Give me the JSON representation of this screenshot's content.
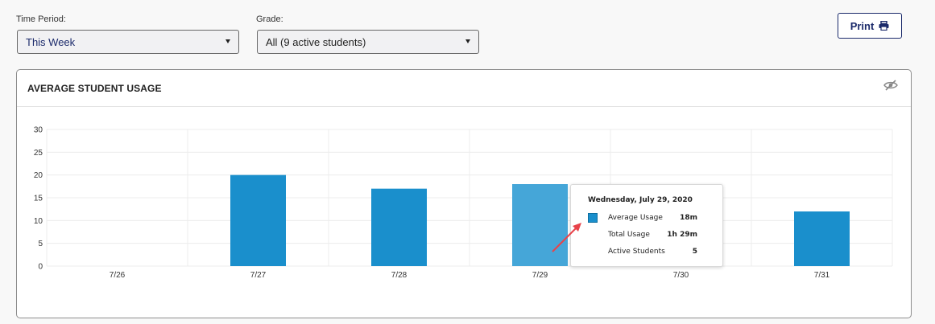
{
  "filters": {
    "time_period": {
      "label": "Time Period:",
      "value": "This Week"
    },
    "grade": {
      "label": "Grade:",
      "value": "All (9 active students)"
    }
  },
  "toolbar": {
    "print_label": "Print"
  },
  "panel": {
    "title": "AVERAGE STUDENT USAGE"
  },
  "chart_data": {
    "type": "bar",
    "title": "",
    "xlabel": "",
    "ylabel": "",
    "categories": [
      "7/26",
      "7/27",
      "7/28",
      "7/29",
      "7/30",
      "7/31"
    ],
    "values": [
      0,
      20,
      17,
      18,
      0,
      12
    ],
    "ylim": [
      0,
      30
    ],
    "yticks": [
      0,
      5,
      10,
      15,
      20,
      25,
      30
    ],
    "grid": true,
    "highlighted_category": "7/29",
    "colors": {
      "bar": "#1a8fcc",
      "bar_highlight": "#45a6d8"
    }
  },
  "tooltip": {
    "title": "Wednesday, July 29, 2020",
    "rows": [
      {
        "label": "Average Usage",
        "value": "18m"
      },
      {
        "label": "Total Usage",
        "value": "1h 29m"
      },
      {
        "label": "Active Students",
        "value": "5"
      }
    ]
  },
  "colors": {
    "accent": "#1b2a6b",
    "arrow": "#e8434a"
  }
}
